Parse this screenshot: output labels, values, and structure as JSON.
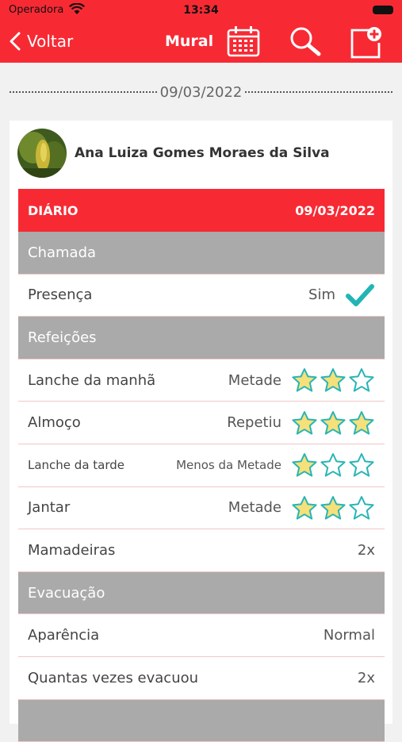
{
  "status_bar": {
    "carrier": "Operadora",
    "time": "13:34"
  },
  "nav": {
    "back_label": "Voltar",
    "title": "Mural"
  },
  "date_separator": "09/03/2022",
  "profile": {
    "name": "Ana Luiza Gomes Moraes da Silva"
  },
  "diary": {
    "label": "DIÁRIO",
    "date": "09/03/2022"
  },
  "sections": {
    "chamada": "Chamada",
    "refeicoes": "Refeições",
    "evacuacao": "Evacuação"
  },
  "presenca": {
    "label": "Presença",
    "value": "Sim"
  },
  "meals": [
    {
      "label": "Lanche da manhã",
      "value": "Metade",
      "stars": 2
    },
    {
      "label": "Almoço",
      "value": "Repetiu",
      "stars": 3
    },
    {
      "label": "Lanche da tarde",
      "value": "Menos da Metade",
      "stars": 1
    },
    {
      "label": "Jantar",
      "value": "Metade",
      "stars": 2
    }
  ],
  "mamadeiras": {
    "label": "Mamadeiras",
    "value": "2x"
  },
  "aparencia": {
    "label": "Aparência",
    "value": "Normal"
  },
  "quantas": {
    "label": "Quantas vezes evacuou",
    "value": "2x"
  },
  "colors": {
    "brand_red": "#f72a34",
    "section_gray": "#aaaaaa",
    "star_fill": "#f6e07a",
    "star_stroke": "#29b5b5",
    "check": "#22b5b5"
  }
}
